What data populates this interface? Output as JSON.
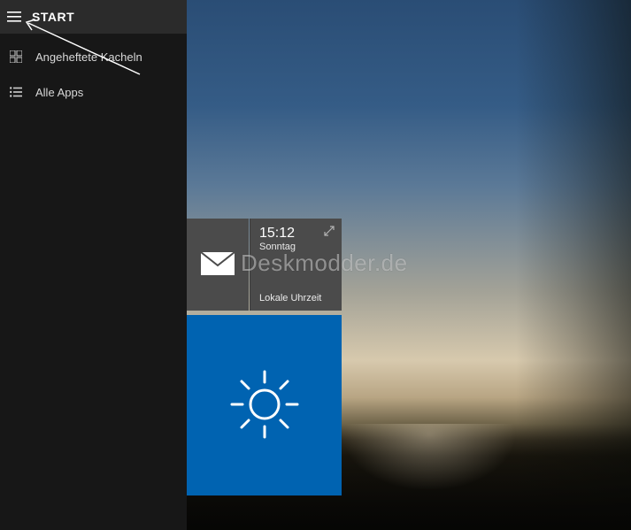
{
  "start": {
    "title": "START",
    "items": [
      {
        "label": "Angeheftete Kacheln"
      },
      {
        "label": "Alle Apps"
      }
    ]
  },
  "tiles": {
    "clock": {
      "time": "15:12",
      "day": "Sonntag",
      "label": "Lokale Uhrzeit"
    }
  },
  "watermark": "Deskmodder.de",
  "icons": {
    "hamburger": "hamburger-icon",
    "pinned": "tiles-icon",
    "allapps": "list-icon",
    "mail": "mail-icon",
    "weather": "sun-icon",
    "expand": "expand-icon"
  }
}
